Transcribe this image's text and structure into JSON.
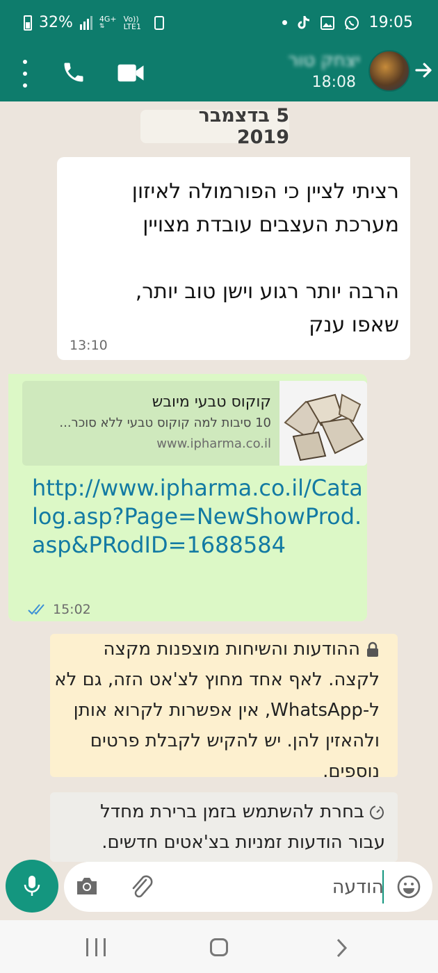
{
  "status_bar": {
    "battery": "32%",
    "network": "4G+",
    "volte": "Vo)) LTE1",
    "time": "19:05",
    "icons": [
      "battery-icon",
      "signal-icon",
      "sim-icon",
      "dot-icon",
      "tiktok-icon",
      "gallery-icon",
      "whatsapp-icon"
    ]
  },
  "header": {
    "contact_name": "יצחק טור",
    "last_seen": "18:08",
    "bg_color": "#0e7c6c",
    "icons": [
      "menu-icon",
      "phone-icon",
      "video-icon",
      "avatar",
      "back-arrow-icon"
    ]
  },
  "chat": {
    "date_label": "5 בדצמבר 2019",
    "messages": [
      {
        "type": "incoming",
        "text": "רציתי לציין כי הפורמולה לאיזון\nמערכת העצבים עובדת מצויין\n\nהרבה יותר רגוע וישן טוב יותר,\nשאפו ענק",
        "time": "13:10"
      },
      {
        "type": "outgoing",
        "preview_title": "קוקוס טבעי מיובש",
        "preview_desc": "10 סיבות למה קוקוס טבעי ללא סוכר...",
        "preview_domain": "www.ipharma.co.il",
        "url": "http://www.ipharma.co.il/Catalog.asp?Page=NewShowProd.asp&PRodID=1688584",
        "time": "15:02",
        "status": "read"
      }
    ],
    "encryption_notice": "ההודעות והשיחות מוצפנות מקצה לקצה. לאף אחד מחוץ לצ'אט הזה, גם לא ל-WhatsApp, אין אפשרות לקרוא אותן ולהאזין להן. יש להקיש לקבלת פרטים נוספים.",
    "timer_notice": "בחרת להשתמש בזמן ברירת מחדל עבור הודעות זמניות בצ'אטים חדשים."
  },
  "input_bar": {
    "placeholder": "הודעה",
    "icons": [
      "mic-icon",
      "camera-icon",
      "attach-icon",
      "emoji-icon"
    ]
  },
  "nav": {
    "icons": [
      "recent-apps-icon",
      "home-icon",
      "back-icon"
    ]
  }
}
